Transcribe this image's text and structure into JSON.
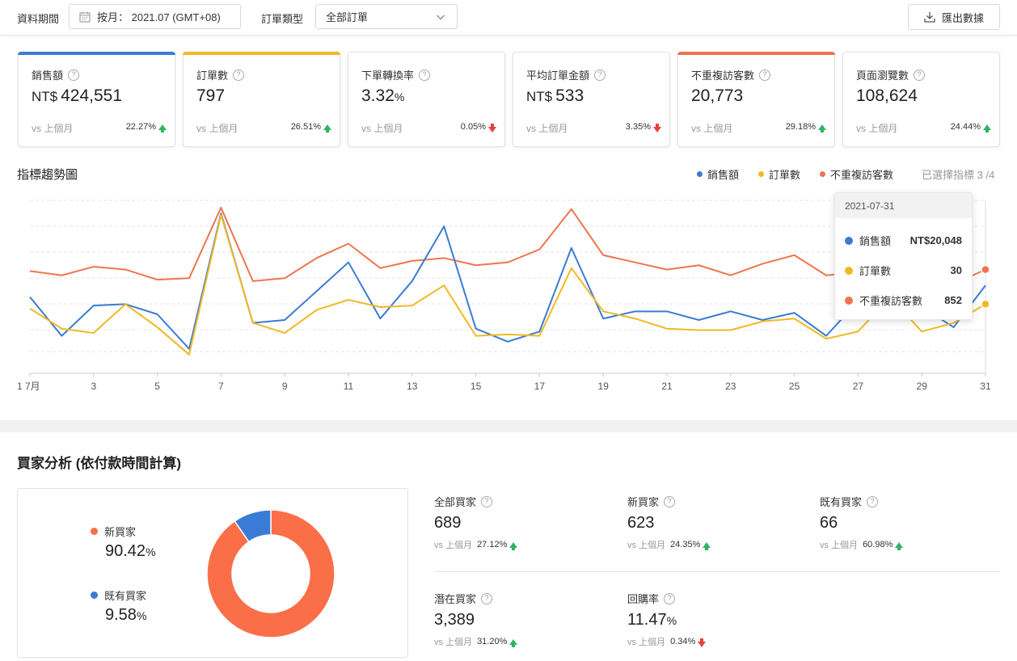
{
  "filters": {
    "period_label": "資料期間",
    "period_value": "按月： 2021.07 (GMT+08)",
    "order_type_label": "訂單類型",
    "order_type_value": "全部訂單",
    "export_label": "匯出數據"
  },
  "cards": [
    {
      "title": "銷售額",
      "prefix": "NT$",
      "value": "424,551",
      "suffix": "",
      "vs": "vs 上個月",
      "pct": "22.27%",
      "dir": "up",
      "accent": "#3a7bd5"
    },
    {
      "title": "訂單數",
      "prefix": "",
      "value": "797",
      "suffix": "",
      "vs": "vs 上個月",
      "pct": "26.51%",
      "dir": "up",
      "accent": "#f0b923"
    },
    {
      "title": "下單轉換率",
      "prefix": "",
      "value": "3.32",
      "suffix": "%",
      "vs": "vs 上個月",
      "pct": "0.05%",
      "dir": "down",
      "accent": ""
    },
    {
      "title": "平均訂單金額",
      "prefix": "NT$",
      "value": "533",
      "suffix": "",
      "vs": "vs 上個月",
      "pct": "3.35%",
      "dir": "down",
      "accent": ""
    },
    {
      "title": "不重複訪客數",
      "prefix": "",
      "value": "20,773",
      "suffix": "",
      "vs": "vs 上個月",
      "pct": "29.18%",
      "dir": "up",
      "accent": "#ee7550"
    },
    {
      "title": "頁面瀏覽數",
      "prefix": "",
      "value": "108,624",
      "suffix": "",
      "vs": "vs 上個月",
      "pct": "24.44%",
      "dir": "up",
      "accent": ""
    }
  ],
  "trend": {
    "title": "指標趨勢圖",
    "selected_count": "已選擇指標 3 /4",
    "legend": [
      {
        "name": "銷售額",
        "color": "#3a7bd5"
      },
      {
        "name": "訂單數",
        "color": "#f0b923"
      },
      {
        "name": "不重複訪客數",
        "color": "#ee7550"
      }
    ],
    "tooltip": {
      "date": "2021-07-31",
      "rows": [
        {
          "name": "銷售額",
          "value": "NT$20,048",
          "color": "#3a7bd5"
        },
        {
          "name": "訂單數",
          "value": "30",
          "color": "#f0b923"
        },
        {
          "name": "不重複訪客數",
          "value": "852",
          "color": "#ee7550"
        }
      ]
    }
  },
  "chart_data": {
    "type": "line",
    "x": [
      1,
      2,
      3,
      4,
      5,
      6,
      7,
      8,
      9,
      10,
      11,
      12,
      13,
      14,
      15,
      16,
      17,
      18,
      19,
      20,
      21,
      22,
      23,
      24,
      25,
      26,
      27,
      28,
      29,
      30,
      31
    ],
    "x_tick_labels": [
      "1 7月",
      "3",
      "5",
      "7",
      "9",
      "11",
      "13",
      "15",
      "17",
      "19",
      "21",
      "23",
      "25",
      "27",
      "29",
      "31"
    ],
    "grid": true,
    "series": [
      {
        "name": "銷售額",
        "color": "#3a7bd5",
        "values": [
          53,
          26,
          47,
          48,
          41,
          17,
          111,
          35,
          37,
          57,
          77,
          38,
          64,
          102,
          31,
          22,
          29,
          87,
          38,
          43,
          43,
          37,
          43,
          37,
          42,
          26,
          50,
          47,
          46,
          32,
          61
        ]
      },
      {
        "name": "訂單數",
        "color": "#f0b923",
        "values": [
          45,
          31,
          28,
          48,
          32,
          13,
          110,
          35,
          28,
          44,
          51,
          46,
          47,
          61,
          26,
          27,
          26,
          73,
          43,
          38,
          31,
          30,
          30,
          36,
          38,
          24,
          29,
          53,
          29,
          35,
          48
        ]
      },
      {
        "name": "不重複訪客數",
        "color": "#ee7550",
        "values": [
          71,
          68,
          74,
          72,
          65,
          66,
          115,
          64,
          66,
          80,
          90,
          73,
          78,
          80,
          75,
          77,
          86,
          114,
          82,
          77,
          72,
          75,
          68,
          76,
          82,
          68,
          70,
          70,
          66,
          62,
          72
        ]
      }
    ]
  },
  "buyers": {
    "title": "買家分析 (依付款時間計算)",
    "legend": [
      {
        "name": "新買家",
        "pct": "90.42",
        "color": "#fa6f48"
      },
      {
        "name": "既有買家",
        "pct": "9.58",
        "color": "#3a7bd5"
      }
    ],
    "pct_suffix": "%",
    "stats": [
      {
        "title": "全部買家",
        "value": "689",
        "suffix": "",
        "vs": "vs 上個月",
        "pct": "27.12%",
        "dir": "up"
      },
      {
        "title": "新買家",
        "value": "623",
        "suffix": "",
        "vs": "vs 上個月",
        "pct": "24.35%",
        "dir": "up"
      },
      {
        "title": "既有買家",
        "value": "66",
        "suffix": "",
        "vs": "vs 上個月",
        "pct": "60.98%",
        "dir": "up"
      },
      {
        "title": "潛在買家",
        "value": "3,389",
        "suffix": "",
        "vs": "vs 上個月",
        "pct": "31.20%",
        "dir": "up"
      },
      {
        "title": "回購率",
        "value": "11.47",
        "suffix": "%",
        "vs": "vs 上個月",
        "pct": "0.34%",
        "dir": "down"
      }
    ]
  }
}
